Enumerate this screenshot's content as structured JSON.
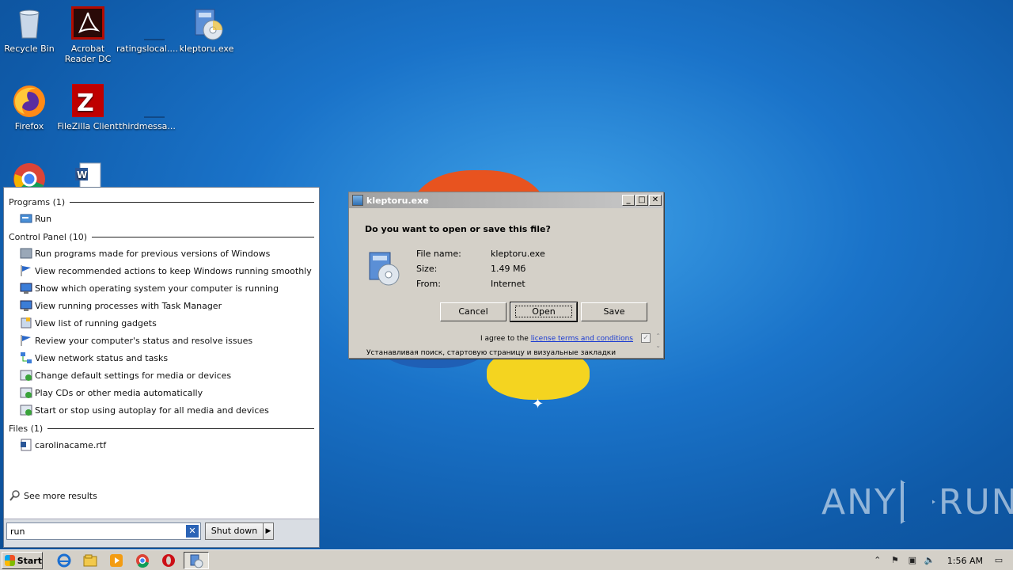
{
  "desktop": {
    "icons": [
      {
        "label": "Recycle Bin",
        "icon": "recycle-bin-icon"
      },
      {
        "label": "Acrobat Reader DC",
        "icon": "acrobat-icon"
      },
      {
        "label": "ratingslocal....",
        "icon": "blank-file-icon"
      },
      {
        "label": "kleptoru.exe",
        "icon": "installer-icon"
      },
      {
        "label": "Firefox",
        "icon": "firefox-icon"
      },
      {
        "label": "FileZilla Client",
        "icon": "filezilla-icon"
      },
      {
        "label": "thirdmessa...",
        "icon": "blank-file-icon"
      },
      {
        "label": "",
        "icon": "chrome-icon"
      },
      {
        "label": "",
        "icon": "word-doc-icon"
      }
    ]
  },
  "start_menu": {
    "programs_header": "Programs (1)",
    "programs": [
      "Run"
    ],
    "control_panel_header": "Control Panel (10)",
    "control_panel": [
      "Run programs made for previous versions of Windows",
      "View recommended actions to keep Windows running smoothly",
      "Show which operating system your computer is running",
      "View running processes with Task Manager",
      "View list of running gadgets",
      "Review your computer's status and resolve issues",
      "View network status and tasks",
      "Change default settings for media or devices",
      "Play CDs or other media automatically",
      "Start or stop using autoplay for all media and devices"
    ],
    "files_header": "Files (1)",
    "files": [
      "carolinacame.rtf"
    ],
    "see_more": "See more results",
    "search_value": "run",
    "search_clear": "✕",
    "shutdown_label": "Shut down",
    "shutdown_arrow": "▶"
  },
  "dialog": {
    "title": "kleptoru.exe",
    "min": "_",
    "max": "□",
    "close": "✕",
    "question": "Do you want to open or save this file?",
    "file_name_label": "File name:",
    "file_name": "kleptoru.exe",
    "size_label": "Size:",
    "size": "1.49 Мб",
    "from_label": "From:",
    "from": "Internet",
    "cancel": "Cancel",
    "open": "Open",
    "save": "Save",
    "agree_prefix": "I agree to the",
    "agree_link": "license terms and conditions",
    "agree_check": "✓",
    "bottom_text": "Устанавливая поиск, стартовую страницу и визуальные закладки"
  },
  "watermark": {
    "left": "ANY",
    "right": "RUN"
  },
  "taskbar": {
    "start_label": "Start",
    "clock": "1:56 AM",
    "tray_up": "⌃"
  }
}
